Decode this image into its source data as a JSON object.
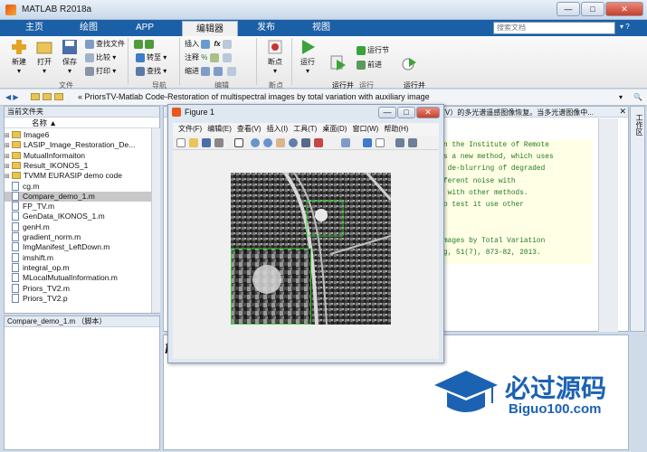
{
  "window": {
    "title": "MATLAB R2018a"
  },
  "tabs": [
    {
      "label": "主页"
    },
    {
      "label": "绘图"
    },
    {
      "label": "APP"
    },
    {
      "label": "编辑器"
    },
    {
      "label": "发布"
    },
    {
      "label": "视图"
    }
  ],
  "search": {
    "placeholder": "搜索文档"
  },
  "ribbon": {
    "new": "新建",
    "open": "打开",
    "save": "保存",
    "find_files": "查找文件",
    "compare": "比较",
    "print": "打印",
    "go_to": "转至",
    "find": "查找",
    "insert": "插入",
    "comment": "注释",
    "indent": "缩进",
    "fx": "fx",
    "breakpoint": "断点",
    "run": "运行",
    "run_advance": "运行并\n前进",
    "run_section": "运行节",
    "advance": "前进",
    "run_time": "运行并\n计时",
    "group_file": "文件",
    "group_nav": "导航",
    "group_edit": "编辑",
    "group_bp": "断点",
    "group_run": "运行"
  },
  "address": {
    "path": "« PriorsTV-Matlab Code-Restoration of multispectral images by total variation with auxiliary image"
  },
  "current_folder": {
    "title": "当前文件夹",
    "column": "名称 ▲",
    "items": [
      {
        "name": "Image6",
        "type": "folder"
      },
      {
        "name": "LASIP_Image_Restoration_De...",
        "type": "folder"
      },
      {
        "name": "MutualInformaiton",
        "type": "folder"
      },
      {
        "name": "Result_IKONOS_1",
        "type": "folder"
      },
      {
        "name": "TVMM EURASIP demo code",
        "type": "folder"
      },
      {
        "name": "cg.m",
        "type": "file"
      },
      {
        "name": "Compare_demo_1.m",
        "type": "file",
        "selected": true
      },
      {
        "name": "FP_TV.m",
        "type": "file"
      },
      {
        "name": "GenData_IKONOS_1.m",
        "type": "file"
      },
      {
        "name": "genH.m",
        "type": "file"
      },
      {
        "name": "gradient_norm.m",
        "type": "file"
      },
      {
        "name": "ImgManifest_LeftDown.m",
        "type": "file"
      },
      {
        "name": "imshift.m",
        "type": "file"
      },
      {
        "name": "integral_op.m",
        "type": "file"
      },
      {
        "name": "MLocalMutualInformation.m",
        "type": "file"
      },
      {
        "name": "Priors_TV2.m",
        "type": "file"
      },
      {
        "name": "Priors_TV2.p",
        "type": "file"
      }
    ],
    "details": "Compare_demo_1.m （脚本）"
  },
  "editor": {
    "header_text": "TV）的多光谱遥感图像恢复。当多光谱图像中...",
    "code_lines": [
      "n the Institute of Remote",
      "s a new method, which uses",
      " de-blurring of degraded",
      "ferent noise with",
      " with other methods.",
      "o test it use other",
      "",
      "",
      "mages by Total Variation",
      "g, 51(7), 873-82, 2013."
    ],
    "side_tab": "工作区"
  },
  "figure": {
    "title": "Figure 1",
    "menu": [
      "文件(F)",
      "编辑(E)",
      "查看(V)",
      "插入(I)",
      "工具(T)",
      "桌面(D)",
      "窗口(W)",
      "帮助(H)"
    ]
  },
  "watermark": {
    "cn": "必过源码",
    "url": "Biguo100.com"
  },
  "colors": {
    "accent": "#1b5fa6",
    "folder": "#e6c456",
    "code_green": "#1f7a1f"
  }
}
